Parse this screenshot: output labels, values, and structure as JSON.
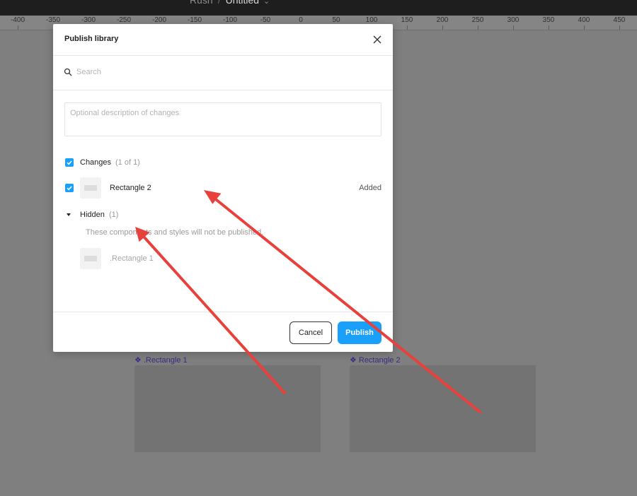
{
  "topbar": {
    "project": "Rush",
    "separator": "/",
    "file": "Untitled",
    "chevron": "⌄"
  },
  "ruler": {
    "ticks": [
      "-400",
      "-350",
      "-300",
      "-250",
      "-200",
      "-150",
      "-100",
      "-50",
      "0",
      "50",
      "100",
      "150",
      "200",
      "250",
      "300",
      "350",
      "400",
      "450"
    ]
  },
  "canvas": {
    "frames": [
      {
        "label": ".Rectangle 1",
        "glyph": "❖"
      },
      {
        "label": "Rectangle 2",
        "glyph": "❖"
      }
    ]
  },
  "modal": {
    "title": "Publish library",
    "search": {
      "placeholder": "Search",
      "value": ""
    },
    "description": {
      "placeholder": "Optional description of changes",
      "value": ""
    },
    "changes": {
      "label": "Changes",
      "count": "(1 of 1)",
      "checked": true,
      "items": [
        {
          "name": "Rectangle 2",
          "status": "Added",
          "checked": true
        }
      ]
    },
    "hidden": {
      "label": "Hidden",
      "count": "(1)",
      "expanded": true,
      "note": "These components and styles will not be published.",
      "items": [
        {
          "name": ".Rectangle 1"
        }
      ]
    },
    "buttons": {
      "cancel": "Cancel",
      "publish": "Publish"
    }
  },
  "colors": {
    "accent": "#18a0fb",
    "annotation": "#e8413c",
    "frame_label": "#3b2a86",
    "backdrop": "#7f7f7f"
  },
  "icons": {
    "close": "close-icon",
    "search": "search-icon",
    "check": "check-icon",
    "caret": "caret-down-icon",
    "component": "component-icon"
  }
}
